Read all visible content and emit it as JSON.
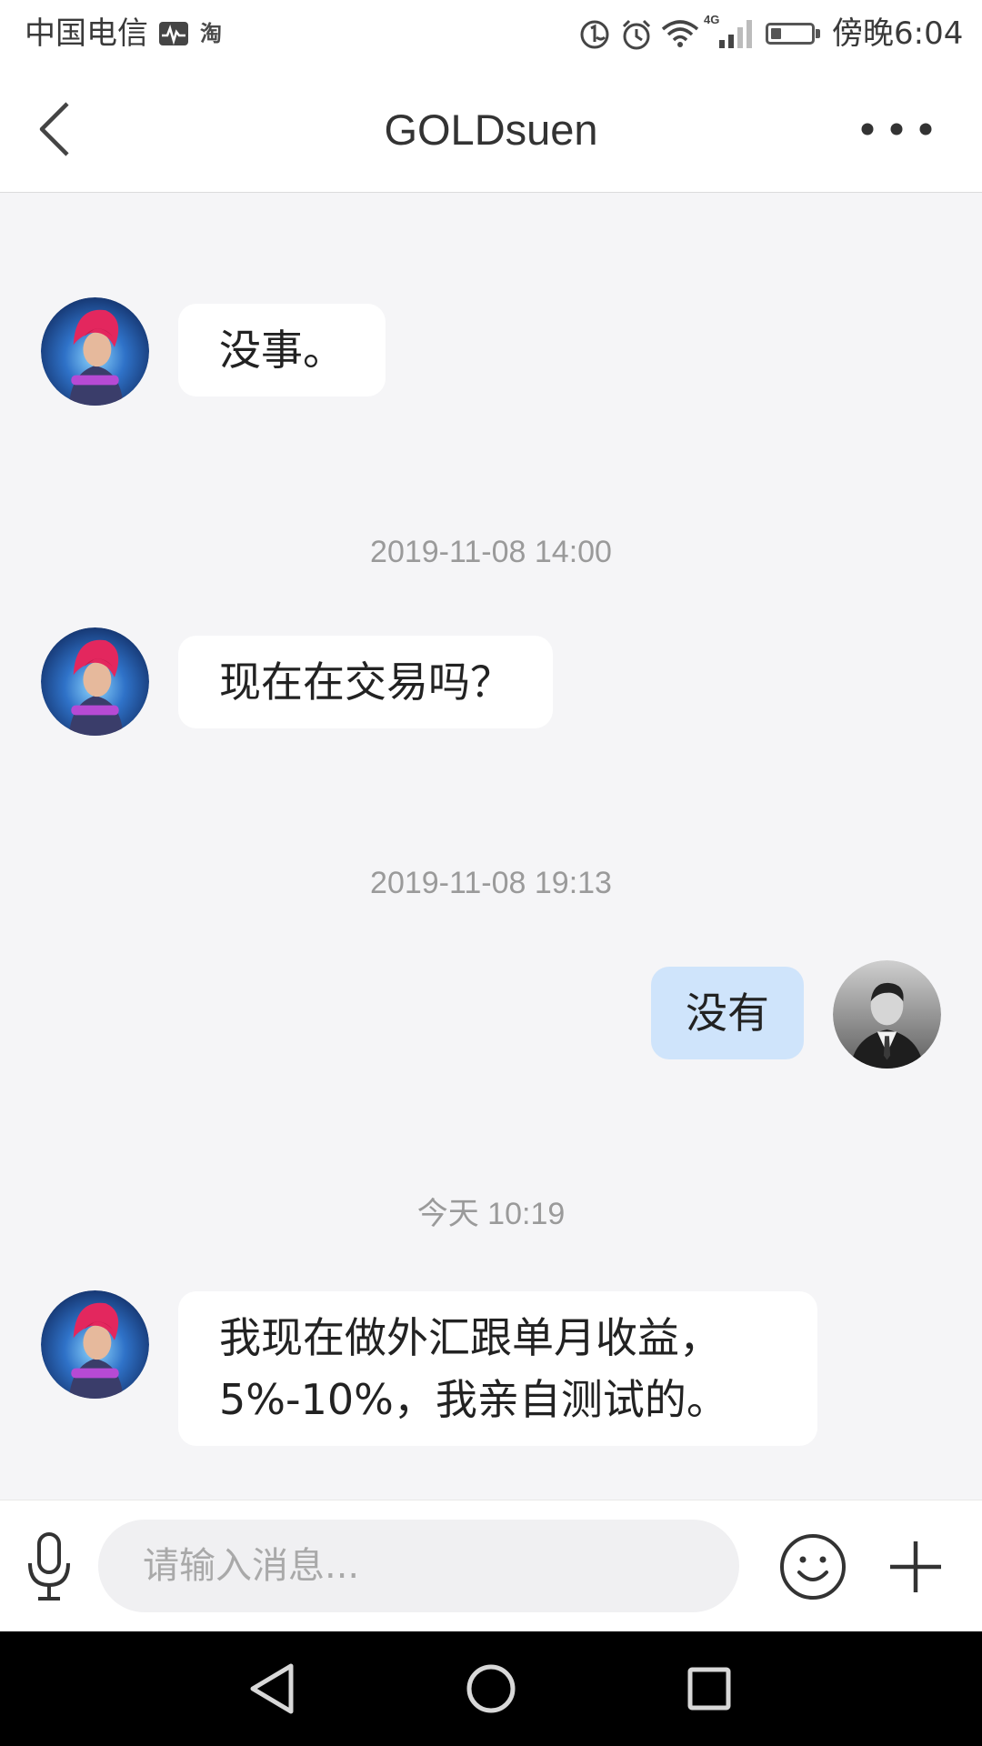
{
  "status_bar": {
    "carrier": "中国电信",
    "notification_badge": "淘",
    "network_type": "4G",
    "time": "傍晚6:04",
    "battery_level": 0.25,
    "icons": [
      "activity-monitor-icon",
      "hd-voice-icon",
      "alarm-icon",
      "wifi-icon",
      "signal-icon",
      "battery-icon"
    ]
  },
  "header": {
    "title": "GOLDsuen",
    "back_icon": "chevron-left-icon",
    "more_icon": "more-horizontal-icon"
  },
  "conversation": [
    {
      "type": "message",
      "direction": "incoming",
      "avatar": "contact-avatar",
      "text": "没事。"
    },
    {
      "type": "timestamp",
      "text": "2019-11-08 14:00"
    },
    {
      "type": "message",
      "direction": "incoming",
      "avatar": "contact-avatar",
      "text": "现在在交易吗？"
    },
    {
      "type": "timestamp",
      "text": "2019-11-08 19:13"
    },
    {
      "type": "message",
      "direction": "outgoing",
      "avatar": "self-avatar",
      "text": "没有"
    },
    {
      "type": "timestamp",
      "text": "今天 10:19"
    },
    {
      "type": "message",
      "direction": "incoming",
      "avatar": "contact-avatar",
      "lines": [
        "我现在做外汇跟单月收益，",
        "5%-10%，我亲自测试的。"
      ]
    }
  ],
  "composer": {
    "placeholder": "请输入消息...",
    "voice_icon": "microphone-icon",
    "emoji_icon": "emoji-smile-icon",
    "attach_icon": "plus-icon"
  },
  "nav_bar": {
    "icons": [
      "back-triangle-icon",
      "home-circle-icon",
      "recents-square-icon"
    ]
  },
  "colors": {
    "chat_background": "#f5f5f7",
    "incoming_bubble": "#ffffff",
    "outgoing_bubble": "#cfe4fb",
    "timestamp_text": "#9a9a9a",
    "message_text": "#222222",
    "nav_bar": "#000000"
  }
}
